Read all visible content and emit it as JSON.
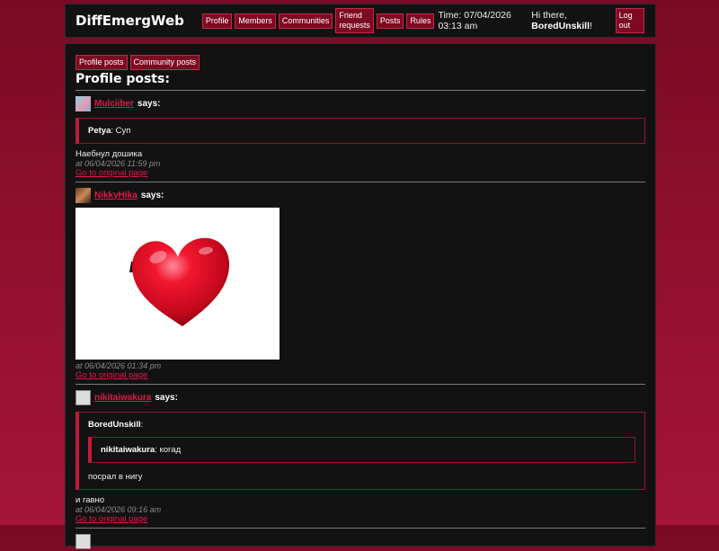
{
  "site": {
    "brand": "DiffEmergWeb"
  },
  "nav": {
    "items": [
      "Profile",
      "Members",
      "Communities",
      "Friend requests",
      "Posts",
      "Rules"
    ],
    "time": "Time: 07/04/2026 03:13 am",
    "greeting_prefix": "Hi there, ",
    "username": "BoredUnskill",
    "greeting_suffix": "!",
    "logout": "Log out"
  },
  "tabs": [
    "Profile posts",
    "Community posts"
  ],
  "page_title": "Profile posts:",
  "posts": [
    {
      "author": "Mulciiber",
      "says": "says:",
      "quote_author": "Petya",
      "quote_text": ": Суп",
      "body": "Наебнул дошика",
      "timestamp": "at 06/04/2026 11:59 pm",
      "link": "Go to original page"
    },
    {
      "author": "NikkyHika",
      "says": "says:",
      "timestamp": "at 06/04/2026 01:34 pm",
      "link": "Go to original page"
    },
    {
      "author": "nikitaiwakura",
      "says": "says:",
      "quote_author": "BoredUnskill",
      "quote_suffix": ":",
      "inner_quote_author": "nikitaiwakura",
      "inner_quote_text": ": когад",
      "quote_text": "посрал в нигу",
      "body": "и гавно",
      "timestamp": "at 06/04/2026 09:16 am",
      "link": "Go to original page"
    }
  ],
  "colors": {
    "accent": "#e0194a",
    "button_bg": "#7d0a22",
    "panel_bg": "#121212",
    "page_bg": "#8d0f2c"
  },
  "icons": [
    "avatar-icon",
    "heart-image"
  ]
}
